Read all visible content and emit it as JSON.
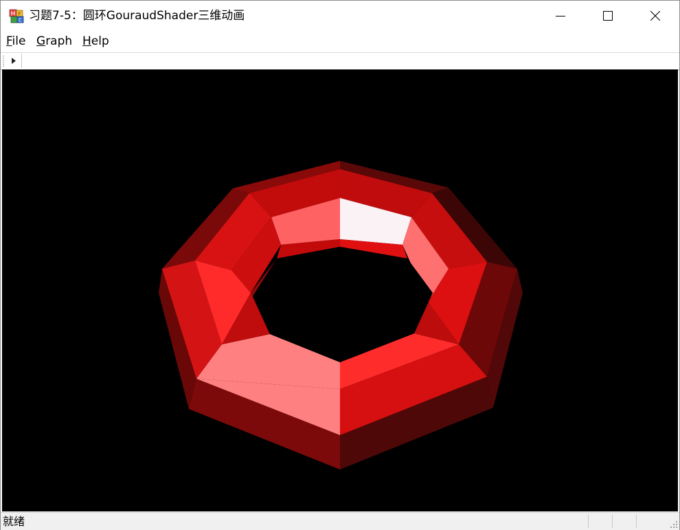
{
  "window": {
    "title": "习题7-5：圆环GouraudShader三维动画",
    "icon": "mfc-app-icon"
  },
  "title_buttons": {
    "minimize_icon": "minimize-icon",
    "maximize_icon": "maximize-icon",
    "close_icon": "close-icon"
  },
  "menu": {
    "items": [
      {
        "accel": "F",
        "rest": "ile"
      },
      {
        "accel": "G",
        "rest": "raph"
      },
      {
        "accel": "H",
        "rest": "elp"
      }
    ]
  },
  "toolbar": {
    "play_icon": "play-icon"
  },
  "scene": {
    "background": "#000000",
    "object": "red-octagonal-torus",
    "base_color": "#ff0000"
  },
  "status": {
    "text": "就绪"
  }
}
